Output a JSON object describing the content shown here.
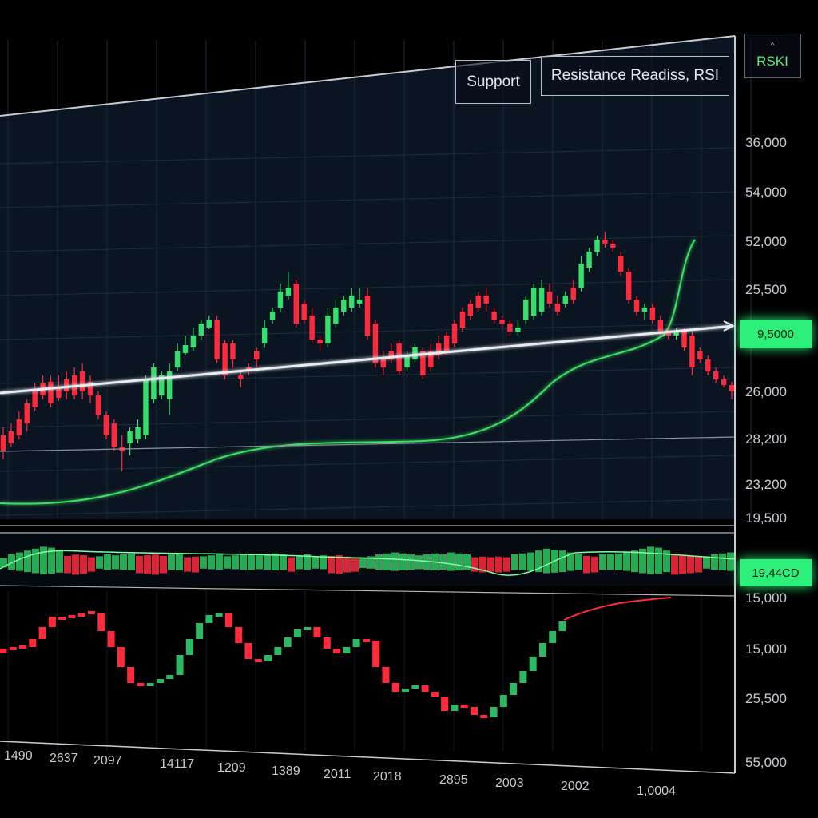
{
  "toolbar": {
    "support_label": "Support",
    "resistance_label": "Resistance  Readiss, RSI",
    "rsi_label": "RSKI",
    "rsi_chevron": "^"
  },
  "price_tags": {
    "main_value": "9,5000",
    "macd_value": "19,44CD"
  },
  "colors": {
    "background": "#000000",
    "plot_bg": "#0b1522",
    "grid": "#1c2c40",
    "up": "#32e06a",
    "down": "#ff2a3c",
    "moving_average": "#3ee060",
    "trendline": "#e8ecf0",
    "border": "#c8ccd2",
    "axis_text": "#c8ccd2"
  },
  "chart_data": [
    {
      "type": "candlestick",
      "panel": "price",
      "y_tick_labels": [
        "36,000",
        "54,000",
        "52,000",
        "25,500",
        "26,000",
        "28,200",
        "23,200",
        "19,500"
      ],
      "candles": [
        {
          "o": 545,
          "c": 565,
          "h": 575,
          "l": 535
        },
        {
          "o": 540,
          "c": 555,
          "h": 560,
          "l": 530
        },
        {
          "o": 525,
          "c": 545,
          "h": 550,
          "l": 515
        },
        {
          "o": 505,
          "c": 530,
          "h": 540,
          "l": 500
        },
        {
          "o": 490,
          "c": 510,
          "h": 515,
          "l": 480
        },
        {
          "o": 480,
          "c": 495,
          "h": 500,
          "l": 470
        },
        {
          "o": 478,
          "c": 505,
          "h": 510,
          "l": 470
        },
        {
          "o": 485,
          "c": 498,
          "h": 502,
          "l": 470
        },
        {
          "o": 475,
          "c": 490,
          "h": 500,
          "l": 465
        },
        {
          "o": 470,
          "c": 495,
          "h": 500,
          "l": 460
        },
        {
          "o": 465,
          "c": 490,
          "h": 500,
          "l": 455
        },
        {
          "o": 478,
          "c": 495,
          "h": 505,
          "l": 470
        },
        {
          "o": 495,
          "c": 520,
          "h": 525,
          "l": 490
        },
        {
          "o": 520,
          "c": 545,
          "h": 550,
          "l": 515
        },
        {
          "o": 530,
          "c": 560,
          "h": 565,
          "l": 525
        },
        {
          "o": 560,
          "c": 565,
          "h": 590,
          "l": 545
        },
        {
          "o": 555,
          "c": 540,
          "h": 570,
          "l": 535
        },
        {
          "o": 550,
          "c": 535,
          "h": 555,
          "l": 525
        },
        {
          "o": 545,
          "c": 475,
          "h": 550,
          "l": 470
        },
        {
          "o": 500,
          "c": 460,
          "h": 505,
          "l": 455
        },
        {
          "o": 495,
          "c": 470,
          "h": 500,
          "l": 465
        },
        {
          "o": 500,
          "c": 465,
          "h": 520,
          "l": 455
        },
        {
          "o": 460,
          "c": 440,
          "h": 465,
          "l": 430
        },
        {
          "o": 442,
          "c": 432,
          "h": 445,
          "l": 420
        },
        {
          "o": 435,
          "c": 420,
          "h": 440,
          "l": 410
        },
        {
          "o": 420,
          "c": 405,
          "h": 425,
          "l": 400
        },
        {
          "o": 410,
          "c": 400,
          "h": 412,
          "l": 395
        },
        {
          "o": 400,
          "c": 450,
          "h": 455,
          "l": 395
        },
        {
          "o": 430,
          "c": 470,
          "h": 475,
          "l": 425
        },
        {
          "o": 430,
          "c": 450,
          "h": 460,
          "l": 425
        },
        {
          "o": 470,
          "c": 475,
          "h": 485,
          "l": 465
        },
        {
          "o": 460,
          "c": 465,
          "h": 470,
          "l": 455
        },
        {
          "o": 440,
          "c": 450,
          "h": 460,
          "l": 435
        },
        {
          "o": 430,
          "c": 410,
          "h": 435,
          "l": 400
        },
        {
          "o": 400,
          "c": 390,
          "h": 405,
          "l": 385
        },
        {
          "o": 385,
          "c": 365,
          "h": 390,
          "l": 355
        },
        {
          "o": 370,
          "c": 360,
          "h": 375,
          "l": 340
        },
        {
          "o": 355,
          "c": 405,
          "h": 410,
          "l": 350
        },
        {
          "o": 380,
          "c": 400,
          "h": 405,
          "l": 375
        },
        {
          "o": 395,
          "c": 425,
          "h": 430,
          "l": 385
        },
        {
          "o": 425,
          "c": 430,
          "h": 440,
          "l": 420
        },
        {
          "o": 430,
          "c": 395,
          "h": 435,
          "l": 385
        },
        {
          "o": 405,
          "c": 385,
          "h": 410,
          "l": 375
        },
        {
          "o": 390,
          "c": 375,
          "h": 395,
          "l": 370
        },
        {
          "o": 385,
          "c": 370,
          "h": 390,
          "l": 360
        },
        {
          "o": 380,
          "c": 375,
          "h": 385,
          "l": 360
        },
        {
          "o": 370,
          "c": 420,
          "h": 425,
          "l": 360
        },
        {
          "o": 405,
          "c": 455,
          "h": 460,
          "l": 400
        },
        {
          "o": 450,
          "c": 460,
          "h": 470,
          "l": 440
        },
        {
          "o": 440,
          "c": 450,
          "h": 455,
          "l": 430
        },
        {
          "o": 430,
          "c": 465,
          "h": 470,
          "l": 425
        },
        {
          "o": 460,
          "c": 445,
          "h": 465,
          "l": 440
        },
        {
          "o": 450,
          "c": 435,
          "h": 455,
          "l": 430
        },
        {
          "o": 440,
          "c": 470,
          "h": 475,
          "l": 435
        },
        {
          "o": 440,
          "c": 460,
          "h": 465,
          "l": 430
        },
        {
          "o": 430,
          "c": 445,
          "h": 450,
          "l": 420
        },
        {
          "o": 420,
          "c": 440,
          "h": 445,
          "l": 415
        },
        {
          "o": 405,
          "c": 430,
          "h": 435,
          "l": 400
        },
        {
          "o": 390,
          "c": 410,
          "h": 415,
          "l": 385
        },
        {
          "o": 380,
          "c": 395,
          "h": 400,
          "l": 375
        },
        {
          "o": 370,
          "c": 385,
          "h": 390,
          "l": 365
        },
        {
          "o": 370,
          "c": 380,
          "h": 390,
          "l": 360
        },
        {
          "o": 390,
          "c": 400,
          "h": 405,
          "l": 385
        },
        {
          "o": 400,
          "c": 405,
          "h": 410,
          "l": 395
        },
        {
          "o": 405,
          "c": 415,
          "h": 420,
          "l": 400
        },
        {
          "o": 415,
          "c": 410,
          "h": 420,
          "l": 400
        },
        {
          "o": 400,
          "c": 375,
          "h": 405,
          "l": 370
        },
        {
          "o": 395,
          "c": 360,
          "h": 400,
          "l": 355
        },
        {
          "o": 390,
          "c": 360,
          "h": 395,
          "l": 350
        },
        {
          "o": 365,
          "c": 380,
          "h": 385,
          "l": 355
        },
        {
          "o": 380,
          "c": 390,
          "h": 395,
          "l": 370
        },
        {
          "o": 380,
          "c": 370,
          "h": 385,
          "l": 365
        },
        {
          "o": 360,
          "c": 375,
          "h": 380,
          "l": 350
        },
        {
          "o": 360,
          "c": 330,
          "h": 365,
          "l": 320
        },
        {
          "o": 335,
          "c": 315,
          "h": 340,
          "l": 310
        },
        {
          "o": 315,
          "c": 300,
          "h": 320,
          "l": 295
        },
        {
          "o": 300,
          "c": 305,
          "h": 310,
          "l": 290
        },
        {
          "o": 305,
          "c": 310,
          "h": 315,
          "l": 300
        },
        {
          "o": 320,
          "c": 340,
          "h": 345,
          "l": 315
        },
        {
          "o": 340,
          "c": 375,
          "h": 380,
          "l": 335
        },
        {
          "o": 375,
          "c": 390,
          "h": 395,
          "l": 370
        },
        {
          "o": 390,
          "c": 385,
          "h": 400,
          "l": 380
        },
        {
          "o": 385,
          "c": 400,
          "h": 405,
          "l": 380
        },
        {
          "o": 400,
          "c": 415,
          "h": 420,
          "l": 395
        },
        {
          "o": 415,
          "c": 420,
          "h": 425,
          "l": 410
        },
        {
          "o": 420,
          "c": 415,
          "h": 425,
          "l": 410
        },
        {
          "o": 415,
          "c": 435,
          "h": 440,
          "l": 410
        },
        {
          "o": 420,
          "c": 460,
          "h": 470,
          "l": 415
        },
        {
          "o": 440,
          "c": 450,
          "h": 455,
          "l": 435
        },
        {
          "o": 450,
          "c": 465,
          "h": 470,
          "l": 445
        },
        {
          "o": 465,
          "c": 475,
          "h": 480,
          "l": 460
        },
        {
          "o": 475,
          "c": 482,
          "h": 485,
          "l": 470
        },
        {
          "o": 482,
          "c": 490,
          "h": 500,
          "l": 478
        }
      ]
    },
    {
      "type": "bar",
      "panel": "macd",
      "values": [
        0.3,
        0.5,
        0.6,
        0.7,
        0.8,
        0.9,
        0.85,
        0.75,
        -0.6,
        -0.7,
        -0.65,
        -0.5,
        0.4,
        0.5,
        0.45,
        0.5,
        0.55,
        -0.6,
        -0.65,
        -0.7,
        -0.6,
        0.5,
        0.55,
        -0.5,
        -0.55,
        0.4,
        0.45,
        0.5,
        0.4,
        0.45,
        0.5,
        0.5,
        0.45,
        0.5,
        0.55,
        0.5,
        -0.5,
        0.45,
        0.5,
        0.4,
        0.45,
        -0.6,
        -0.65,
        -0.55,
        -0.5,
        0.35,
        0.4,
        0.5,
        0.55,
        0.6,
        0.55,
        0.5,
        0.45,
        0.5,
        0.55,
        0.5,
        0.6,
        0.55,
        0.5,
        -0.5,
        -0.55,
        -0.5,
        -0.55,
        -0.5,
        0.5,
        0.55,
        0.6,
        0.7,
        0.8,
        0.75,
        0.7,
        0.6,
        0.5,
        -0.6,
        -0.55,
        0.5,
        0.5,
        0.55,
        0.6,
        0.7,
        0.8,
        0.9,
        0.85,
        0.7,
        -0.7,
        -0.65,
        -0.6,
        -0.55,
        0.4,
        0.5,
        0.55,
        0.6
      ]
    },
    {
      "type": "candlestick",
      "panel": "oscillator",
      "y_tick_labels": [
        "15,000",
        "15,000",
        "25,500",
        "55,000"
      ],
      "x_tick_labels": [
        "1490",
        "2637",
        "2097",
        "14117",
        "1209",
        "1389",
        "2011",
        "2018",
        "2895",
        "2003",
        "2002",
        "1,0004"
      ],
      "candles": [
        {
          "o": 812,
          "c": 818
        },
        {
          "o": 810,
          "c": 812
        },
        {
          "o": 808,
          "c": 812
        },
        {
          "o": 800,
          "c": 810
        },
        {
          "o": 785,
          "c": 800
        },
        {
          "o": 772,
          "c": 785
        },
        {
          "o": 772,
          "c": 772
        },
        {
          "o": 770,
          "c": 772
        },
        {
          "o": 768,
          "c": 770
        },
        {
          "o": 765,
          "c": 768
        },
        {
          "o": 768,
          "c": 790
        },
        {
          "o": 790,
          "c": 810
        },
        {
          "o": 810,
          "c": 835
        },
        {
          "o": 835,
          "c": 855
        },
        {
          "o": 855,
          "c": 858
        },
        {
          "o": 858,
          "c": 855
        },
        {
          "o": 855,
          "c": 850
        },
        {
          "o": 850,
          "c": 845
        },
        {
          "o": 845,
          "c": 820
        },
        {
          "o": 820,
          "c": 800
        },
        {
          "o": 800,
          "c": 780
        },
        {
          "o": 780,
          "c": 770
        },
        {
          "o": 770,
          "c": 768
        },
        {
          "o": 768,
          "c": 785
        },
        {
          "o": 785,
          "c": 805
        },
        {
          "o": 805,
          "c": 825
        },
        {
          "o": 825,
          "c": 828
        },
        {
          "o": 828,
          "c": 820
        },
        {
          "o": 820,
          "c": 810
        },
        {
          "o": 810,
          "c": 798
        },
        {
          "o": 798,
          "c": 788
        },
        {
          "o": 788,
          "c": 785
        },
        {
          "o": 785,
          "c": 798
        },
        {
          "o": 798,
          "c": 812
        },
        {
          "o": 812,
          "c": 818
        },
        {
          "o": 818,
          "c": 810
        },
        {
          "o": 810,
          "c": 800
        },
        {
          "o": 800,
          "c": 802
        },
        {
          "o": 802,
          "c": 835
        },
        {
          "o": 835,
          "c": 855
        },
        {
          "o": 855,
          "c": 866
        },
        {
          "o": 866,
          "c": 862
        },
        {
          "o": 862,
          "c": 858
        },
        {
          "o": 858,
          "c": 866
        },
        {
          "o": 866,
          "c": 872
        },
        {
          "o": 872,
          "c": 890
        },
        {
          "o": 890,
          "c": 882
        },
        {
          "o": 882,
          "c": 885
        },
        {
          "o": 885,
          "c": 895
        },
        {
          "o": 895,
          "c": 898
        },
        {
          "o": 898,
          "c": 885
        },
        {
          "o": 885,
          "c": 870
        },
        {
          "o": 870,
          "c": 855
        },
        {
          "o": 855,
          "c": 840
        },
        {
          "o": 840,
          "c": 822
        },
        {
          "o": 822,
          "c": 805
        },
        {
          "o": 805,
          "c": 790
        },
        {
          "o": 790,
          "c": 778
        }
      ]
    }
  ]
}
